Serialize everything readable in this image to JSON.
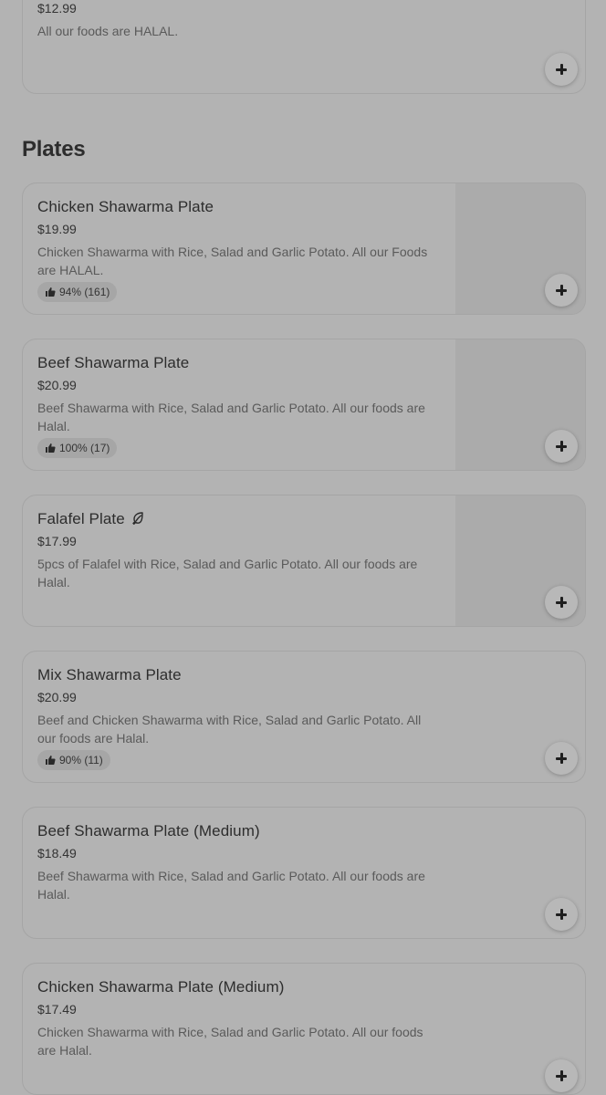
{
  "top_item": {
    "price": "$12.99",
    "description": "All our foods are HALAL."
  },
  "section": {
    "title": "Plates"
  },
  "items": [
    {
      "title": "Chicken Shawarma Plate",
      "price": "$19.99",
      "description": "Chicken Shawarma with Rice, Salad and Garlic Potato. All our Foods are HALAL.",
      "rating": "94% (161)",
      "has_image": true
    },
    {
      "title": "Beef Shawarma Plate",
      "price": "$20.99",
      "description": "Beef Shawarma with Rice, Salad and Garlic Potato. All our foods are Halal.",
      "rating": "100% (17)",
      "has_image": true
    },
    {
      "title": "Falafel Plate",
      "price": "$17.99",
      "description": "5pcs of Falafel with Rice, Salad and Garlic Potato. All our foods are Halal.",
      "badge_icon": "leaf-icon",
      "has_image": true
    },
    {
      "title": "Mix Shawarma Plate",
      "price": "$20.99",
      "description": "Beef and Chicken Shawarma with Rice, Salad and Garlic Potato. All our foods are Halal.",
      "rating": "90% (11)",
      "has_image": false
    },
    {
      "title": "Beef Shawarma Plate (Medium)",
      "price": "$18.49",
      "description": "Beef Shawarma with Rice, Salad and Garlic Potato. All our foods are Halal.",
      "has_image": false
    },
    {
      "title": "Chicken Shawarma Plate (Medium)",
      "price": "$17.49",
      "description": "Chicken Shawarma with Rice, Salad and Garlic Potato. All our foods are Halal.",
      "has_image": false
    }
  ],
  "icons": {
    "add": "plus-icon",
    "rating": "thumbs-up-icon",
    "vegetarian": "leaf-icon"
  },
  "colors": {
    "overlay_background": "#b3b3b3",
    "card_border": "#a5a5a5",
    "text": "#2d2d2d"
  }
}
